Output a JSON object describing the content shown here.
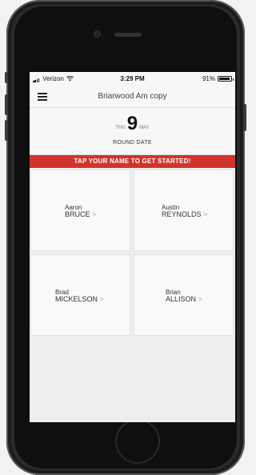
{
  "status_bar": {
    "carrier": "Verizon",
    "time": "3:29 PM",
    "battery_percent": "91%",
    "battery_level": 0.91
  },
  "navbar": {
    "title": "Briarwood Am copy"
  },
  "round": {
    "day_of_week": "THU",
    "day": "9",
    "month": "MAY",
    "label": "ROUND DATE"
  },
  "banner": {
    "text": "TAP YOUR NAME TO GET STARTED!"
  },
  "players": [
    {
      "first": "Aaron",
      "last": "BRUCE"
    },
    {
      "first": "Austin",
      "last": "REYNOLDS"
    },
    {
      "first": "Brad",
      "last": "MICKELSON"
    },
    {
      "first": "Brian",
      "last": "ALLISON"
    }
  ],
  "chevron": ">"
}
